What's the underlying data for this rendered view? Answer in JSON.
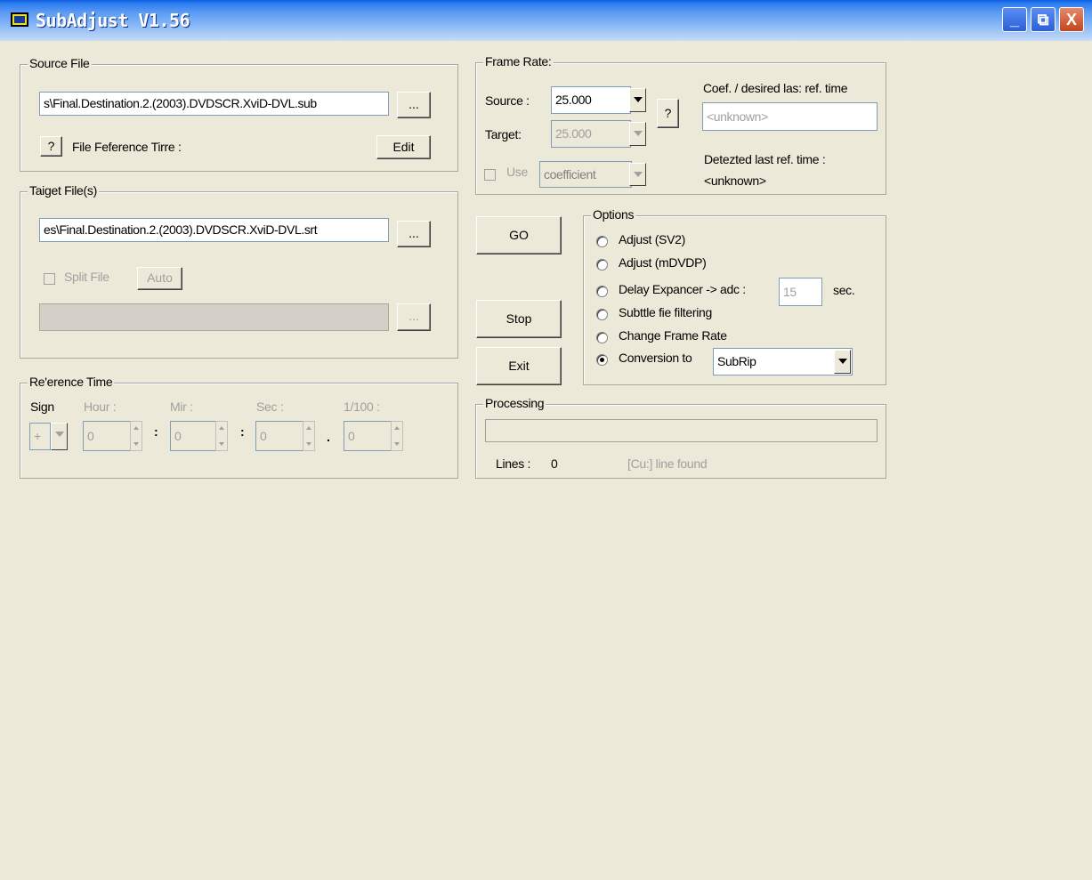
{
  "window": {
    "title": "SubAdjust V1.56",
    "minimize": "_",
    "restore": "⧉",
    "close": "X"
  },
  "source_file": {
    "legend": "Source File",
    "path": "s\\Final.Destination.2.(2003).DVDSCR.XviD-DVL.sub",
    "browse": "...",
    "help": "?",
    "ref_time_label": "File Feference Tirre :",
    "edit": "Edit"
  },
  "target_file": {
    "legend": "Taiget File(s)",
    "path": "es\\Final.Destination.2.(2003).DVDSCR.XviD-DVL.srt",
    "browse": "...",
    "split_label": "Split File",
    "auto": "Auto",
    "browse2": "..."
  },
  "reference_time": {
    "legend": "Re'erence Time",
    "sign_label": "Sign",
    "hour_label": "Hour :",
    "min_label": "Mir :",
    "sec_label": "Sec :",
    "hundredth_label": "1/100 :",
    "sign_value": "+",
    "hour": "0",
    "min": "0",
    "sec": "0",
    "hundredth": "0",
    "sep1": ":",
    "sep2": ":",
    "sep3": "."
  },
  "frame_rates": {
    "legend": "Frame Rate:",
    "source_label": "Source :",
    "source_value": "25.000",
    "target_label": "Target:",
    "target_value": "25.000",
    "help": "?",
    "coef_label": "Coef. / desired las: ref. time",
    "coef_placeholder": "<unknown>",
    "use_label": "Use",
    "use_value": "coefficient",
    "detected_label": "Detezted last ref. time :",
    "detected_value": "<unknown>"
  },
  "actions": {
    "go": "GO",
    "stop": "Stop",
    "exit": "Exit"
  },
  "options": {
    "legend": "Options",
    "items": [
      "Adjust (SV2)",
      "Adjust (mDVDP)",
      "Delay Expancer -> adc :",
      "Subttle fie filtering",
      "Change Frame Rate",
      "Conversion to"
    ],
    "delay_value": "15",
    "delay_unit": "sec.",
    "conversion_value": "SubRip",
    "selected_index": 5
  },
  "processing": {
    "legend": "Processing",
    "lines_label": "Lines :",
    "lines_value": "0",
    "cut_label": "[Cu:] line found",
    "progress": 0
  }
}
